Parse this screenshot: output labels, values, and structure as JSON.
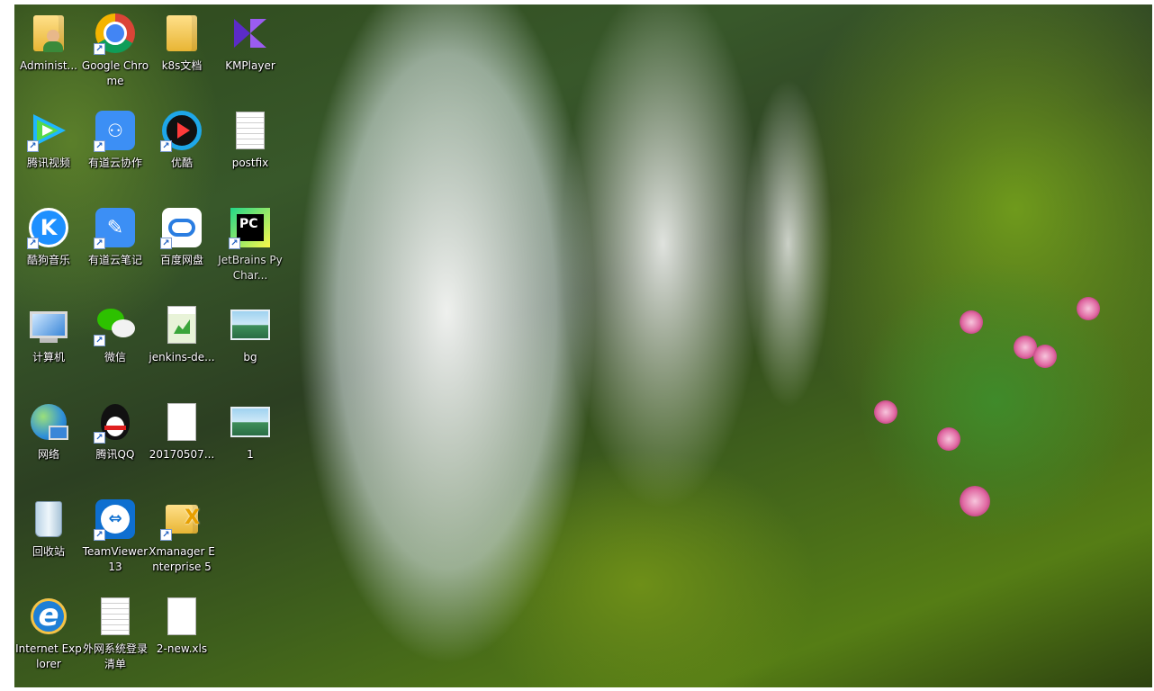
{
  "desktop": {
    "icons": [
      {
        "label": "Administ...",
        "icon": "user-folder-icon"
      },
      {
        "label": "Google Chrome",
        "icon": "chrome-icon"
      },
      {
        "label": "k8s文档",
        "icon": "folder-icon"
      },
      {
        "label": "KMPlayer",
        "icon": "kmplayer-icon"
      },
      {
        "label": "腾讯视频",
        "icon": "tencent-video-icon"
      },
      {
        "label": "有道云协作",
        "icon": "youdao-collab-icon"
      },
      {
        "label": "优酷",
        "icon": "youku-icon"
      },
      {
        "label": "postfix",
        "icon": "text-document-icon"
      },
      {
        "label": "酷狗音乐",
        "icon": "kugou-music-icon"
      },
      {
        "label": "有道云笔记",
        "icon": "youdao-note-icon"
      },
      {
        "label": "百度网盘",
        "icon": "baidu-netdisk-icon"
      },
      {
        "label": "JetBrains PyChar...",
        "icon": "pycharm-icon"
      },
      {
        "label": "计算机",
        "icon": "computer-icon"
      },
      {
        "label": "微信",
        "icon": "wechat-icon"
      },
      {
        "label": "jenkins-de...",
        "icon": "spreadsheet-document-icon"
      },
      {
        "label": "bg",
        "icon": "image-file-icon"
      },
      {
        "label": "网络",
        "icon": "network-globe-icon"
      },
      {
        "label": "腾讯QQ",
        "icon": "qq-penguin-icon"
      },
      {
        "label": "20170507...",
        "icon": "blank-document-icon"
      },
      {
        "label": "1",
        "icon": "image-file-icon"
      },
      {
        "label": "回收站",
        "icon": "recycle-bin-icon"
      },
      {
        "label": "TeamViewer 13",
        "icon": "teamviewer-icon"
      },
      {
        "label": "Xmanager Enterprise 5",
        "icon": "xmanager-folder-icon"
      },
      {
        "label": "Internet Explorer",
        "icon": "internet-explorer-icon"
      },
      {
        "label": "外网系统登录清单",
        "icon": "text-document-icon"
      },
      {
        "label": "2-new.xls",
        "icon": "blank-document-icon"
      }
    ]
  },
  "colors": {
    "chrome_red": "#db4437",
    "chrome_green": "#0f9d58",
    "chrome_yellow": "#f4b400",
    "chrome_blue": "#4285f4",
    "youdao_blue": "#3c8ff5",
    "kugou_blue": "#1e90ff",
    "teamviewer_blue": "#0e6fd0",
    "pycharm_green": "#21d789",
    "kmplayer_purple": "#7b3fe4",
    "wechat_green": "#2dc100"
  }
}
